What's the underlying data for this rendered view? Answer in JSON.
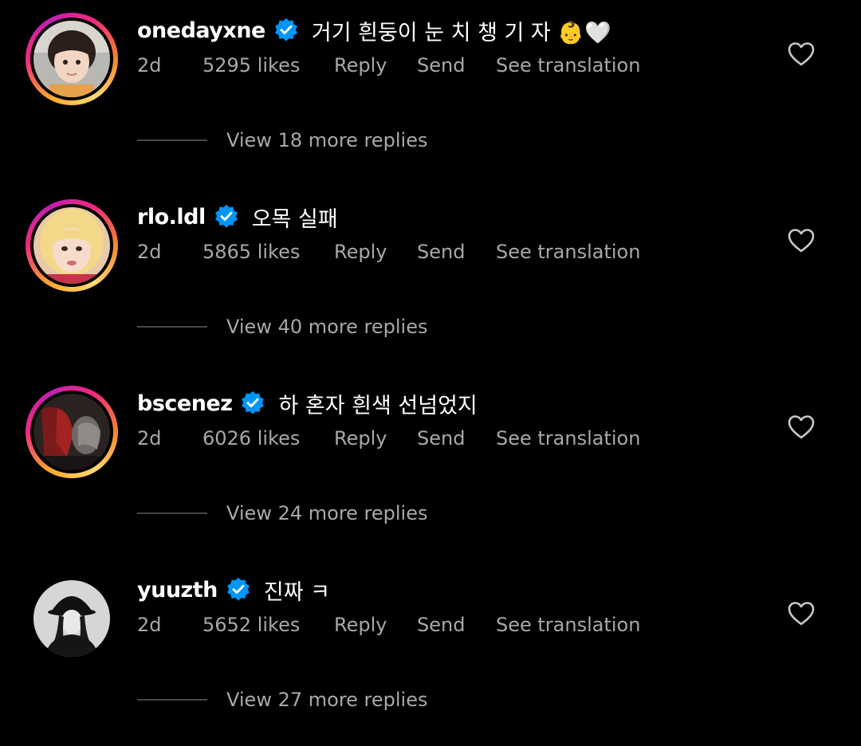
{
  "comments": [
    {
      "username": "onedayxne",
      "text": "거기 흰둥이 눈 치 챙 기 자 👶🤍",
      "time": "2d",
      "likes": "5295 likes",
      "reply_label": "Reply",
      "send_label": "Send",
      "translate_label": "See translation",
      "view_replies": "View 18 more replies"
    },
    {
      "username": "rlo.ldl",
      "text": "오목 실패",
      "time": "2d",
      "likes": "5865 likes",
      "reply_label": "Reply",
      "send_label": "Send",
      "translate_label": "See translation",
      "view_replies": "View 40 more replies"
    },
    {
      "username": "bscenez",
      "text": "하 혼자 흰색 선넘었지",
      "time": "2d",
      "likes": "6026 likes",
      "reply_label": "Reply",
      "send_label": "Send",
      "translate_label": "See translation",
      "view_replies": "View 24 more replies"
    },
    {
      "username": "yuuzth",
      "text": "진짜 ㅋ",
      "time": "2d",
      "likes": "5652 likes",
      "reply_label": "Reply",
      "send_label": "Send",
      "translate_label": "See translation",
      "view_replies": "View 27 more replies"
    }
  ],
  "icons": {
    "verified": "verified-badge-icon",
    "like": "heart-outline-icon"
  },
  "colors": {
    "background": "#000000",
    "primary_text": "#ffffff",
    "secondary_text": "#a8a8a8",
    "verified_blue": "#0095f6",
    "divider": "#474747"
  }
}
